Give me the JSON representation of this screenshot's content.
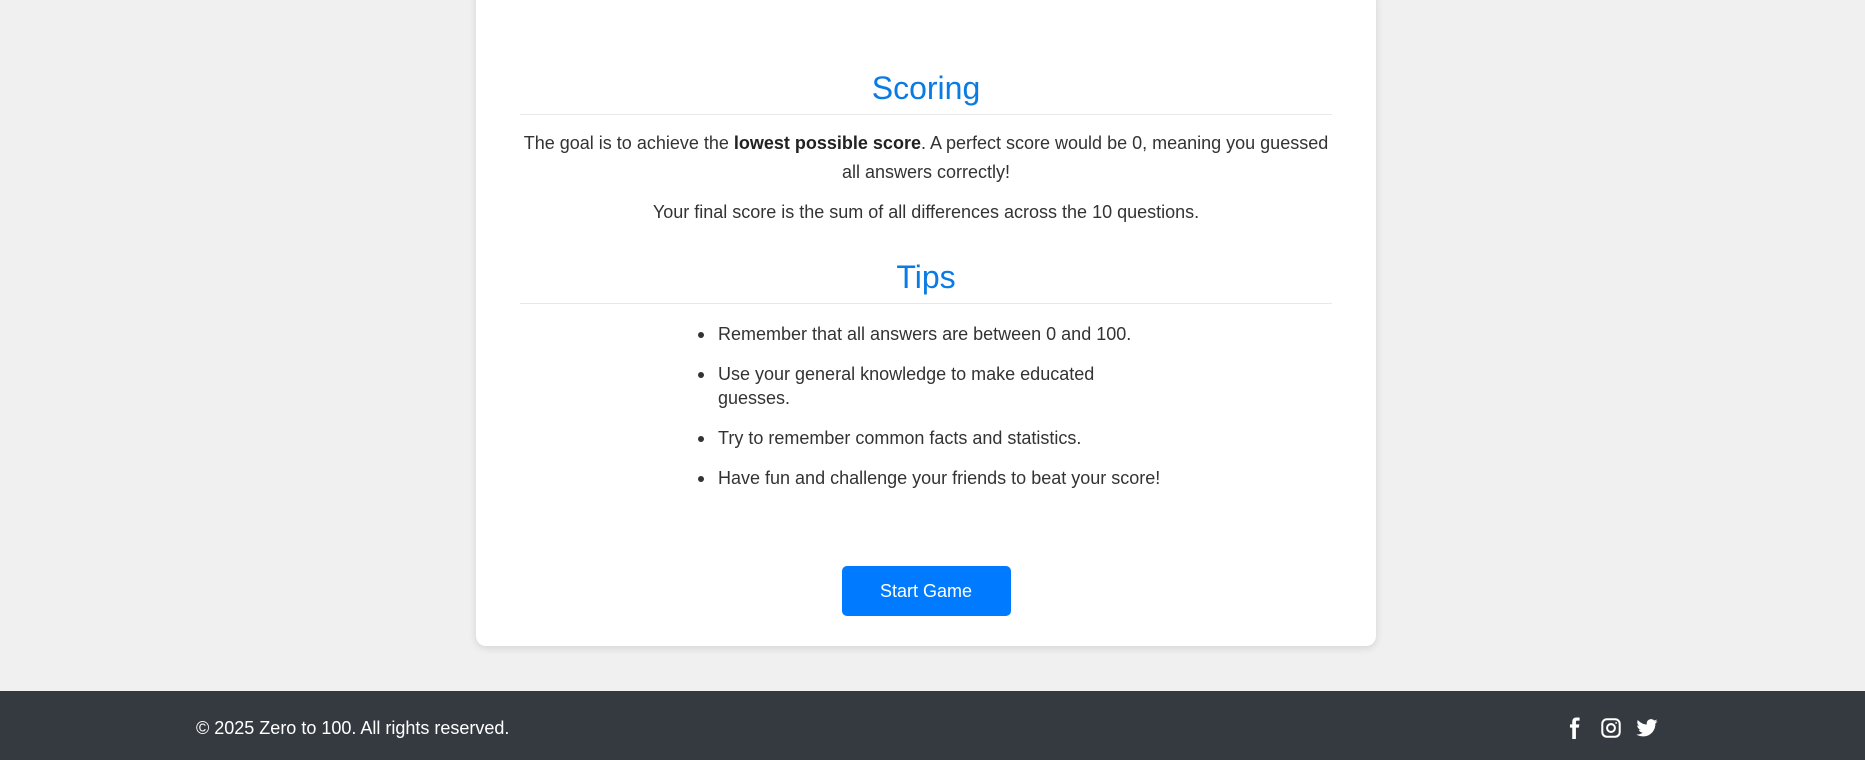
{
  "scoring": {
    "title": "Scoring",
    "p1_before": "The goal is to achieve the ",
    "p1_bold": "lowest possible score",
    "p1_after": ". A perfect score would be 0, meaning you guessed all answers correctly!",
    "p2": "Your final score is the sum of all differences across the 10 questions."
  },
  "tips": {
    "title": "Tips",
    "items": [
      "Remember that all answers are between 0 and 100.",
      "Use your general knowledge to make educated guesses.",
      "Try to remember common facts and statistics.",
      "Have fun and challenge your friends to beat your score!"
    ]
  },
  "start_button_label": "Start Game",
  "footer": {
    "copyright": "© 2025 Zero to 100. All rights reserved.",
    "social_icons": [
      "facebook-icon",
      "instagram-icon",
      "twitter-icon"
    ]
  },
  "colors": {
    "accent": "#007bff",
    "heading": "#0a7be4",
    "footer_bg": "#343a40",
    "page_bg": "#f0f0f0"
  }
}
